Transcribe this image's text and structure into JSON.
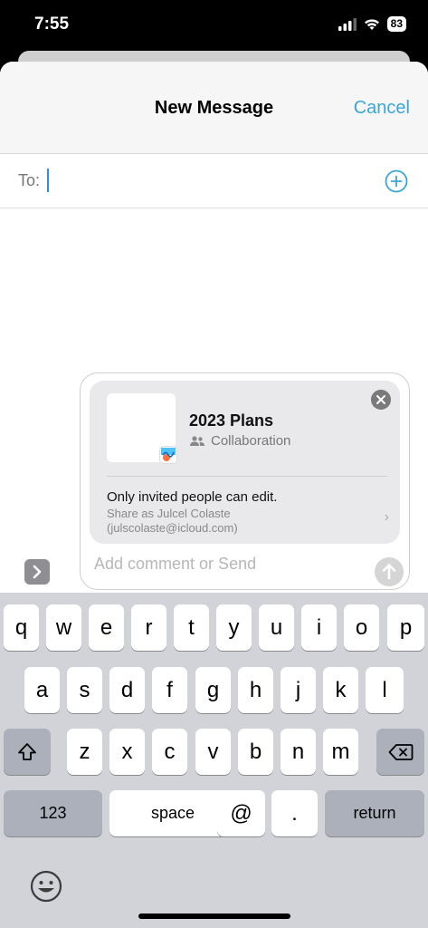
{
  "status": {
    "time": "7:55",
    "battery": "83"
  },
  "header": {
    "title": "New Message",
    "cancel_label": "Cancel"
  },
  "to": {
    "label": "To:"
  },
  "share": {
    "title": "2023 Plans",
    "subtitle": "Collaboration",
    "permission": "Only invited people can edit.",
    "share_as_line1": "Share as Julcel Colaste",
    "share_as_line2": "(julscolaste@icloud.com)"
  },
  "comment": {
    "placeholder": "Add comment or Send"
  },
  "keyboard": {
    "row1": [
      "q",
      "w",
      "e",
      "r",
      "t",
      "y",
      "u",
      "i",
      "o",
      "p"
    ],
    "row2": [
      "a",
      "s",
      "d",
      "f",
      "g",
      "h",
      "j",
      "k",
      "l"
    ],
    "row3": [
      "z",
      "x",
      "c",
      "v",
      "b",
      "n",
      "m"
    ],
    "numbers_label": "123",
    "space_label": "space",
    "at_label": "@",
    "period_label": ".",
    "return_label": "return"
  },
  "colors": {
    "accent": "#3aa6d6",
    "cursor": "#2d8cf0",
    "keyboard_bg": "#d1d3d9",
    "key_dark": "#abb0ba"
  },
  "icons": [
    "signal-icon",
    "wifi-icon",
    "add-contact-icon",
    "people-icon",
    "freeform-app-icon",
    "close-icon",
    "chevron-right-icon",
    "send-arrow-icon",
    "apps-chevron-icon",
    "shift-icon",
    "delete-icon",
    "emoji-icon"
  ]
}
